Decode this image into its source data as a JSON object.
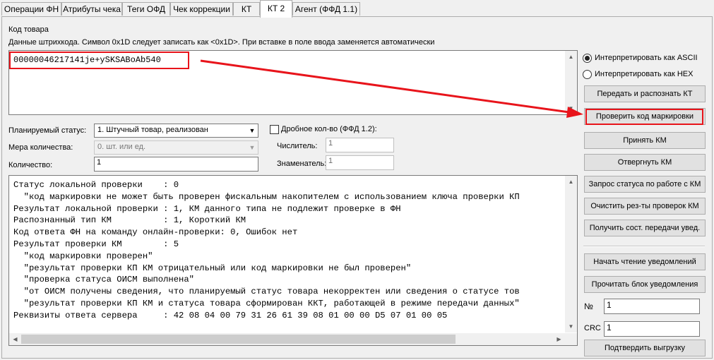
{
  "tabs": [
    {
      "label": "Операции ФН"
    },
    {
      "label": "Атрибуты чека"
    },
    {
      "label": "Теги ОФД"
    },
    {
      "label": "Чек коррекции"
    },
    {
      "label": "КТ"
    },
    {
      "label": "КТ 2"
    },
    {
      "label": "Агент (ФФД 1.1)"
    }
  ],
  "code": {
    "title": "Код товара",
    "hint": "Данные штрихкода. Символ 0x1D следует записать как <0x1D>. При вставке в поле ввода заменяется автоматически",
    "value": "00000046217141je+ySKSABoAb540"
  },
  "radios": {
    "ascii": "Интерпретировать как ASCII",
    "hex": "Интерпретировать как HEX"
  },
  "buttons": {
    "send_parse": "Передать и распознать КТ",
    "check_code": "Проверить код маркировки",
    "accept": "Принять КМ",
    "reject": "Отвергнуть КМ",
    "status_request": "Запрос статуса по работе с КМ",
    "clear_results": "Очистить рез-ты проверок КМ",
    "get_transfer": "Получить сост. передачи увед.",
    "start_read": "Начать чтение уведомлений",
    "read_block": "Прочитать блок уведомления",
    "confirm_upload": "Подтвердить выгрузку"
  },
  "form": {
    "status_label": "Планируемый статус:",
    "status_value": "1. Штучный товар, реализован",
    "measure_label": "Мера количества:",
    "measure_value": "0. шт. или ед.",
    "qty_label": "Количество:",
    "qty_value": "1",
    "fractional_label": "Дробное кол-во (ФФД 1.2):",
    "numerator_label": "Числитель:",
    "numerator_value": "1",
    "denominator_label": "Знаменатель:",
    "denominator_value": "1"
  },
  "output": {
    "lines": [
      "Статус локальной проверки    : 0",
      "  \"код маркировки не может быть проверен фискальным накопителем с использованием ключа проверки КП",
      "Результат локальной проверки : 1, КМ данного типа не подлежит проверке в ФН",
      "Распознанный тип КМ          : 1, Короткий КМ",
      "Код ответа ФН на команду онлайн-проверки: 0, Ошибок нет",
      "Результат проверки КМ        : 5",
      "  \"код маркировки проверен\"",
      "  \"результат проверки КП КМ отрицательный или код маркировки не был проверен\"",
      "  \"проверка статуса ОИСМ выполнена\"",
      "  \"от ОИСМ получены сведения, что планируемый статус товара некорректен или сведения о статусе тов",
      "  \"результат проверки КП КМ и статуса товара сформирован ККТ, работающей в режиме передачи данных\"",
      "Реквизиты ответа сервера     : 42 08 04 00 79 31 26 61 39 08 01 00 00 D5 07 01 00 05"
    ]
  },
  "notify": {
    "num_label": "№",
    "num_value": "1",
    "crc_label": "CRC",
    "crc_value": "1"
  },
  "colors": {
    "highlight": "#e8141b"
  }
}
